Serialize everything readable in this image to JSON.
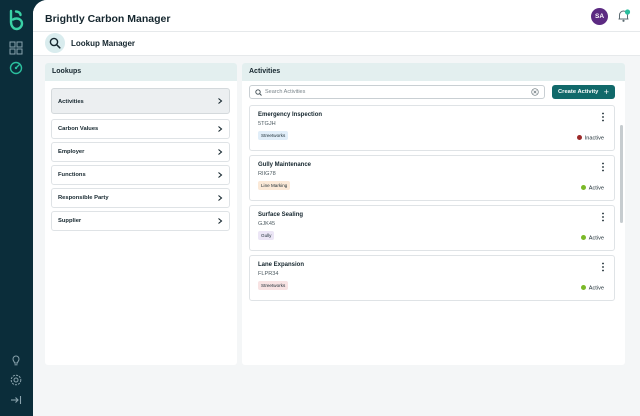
{
  "app": {
    "title": "Brightly Carbon Manager",
    "logo_icon": "brightly-logo-icon"
  },
  "rail": {
    "items": [
      "grid-icon",
      "gauge-icon",
      "lightbulb-icon",
      "settings-icon",
      "logout-icon"
    ]
  },
  "user": {
    "initials": "SA",
    "avatar_color": "#5c2a82"
  },
  "page": {
    "title": "Lookup Manager",
    "icon": "search-icon"
  },
  "lookups": {
    "title": "Lookups",
    "items": [
      {
        "label": "Activities",
        "active": true
      },
      {
        "label": "Carbon Values"
      },
      {
        "label": "Employer"
      },
      {
        "label": "Functions"
      },
      {
        "label": "Responsible Party"
      },
      {
        "label": "Supplier"
      }
    ]
  },
  "activities": {
    "title": "Activities",
    "search_placeholder": "Search Activities",
    "create_label": "Create Activity",
    "create_icon": "+",
    "items": [
      {
        "name": "Emergency Inspection",
        "code": "5TGJH",
        "tag": "Streetworks",
        "tag_color": "#e1eef9",
        "status": "Inactive",
        "status_color": "#9c2a2a"
      },
      {
        "name": "Gully Maintenance",
        "code": "RIIG78",
        "tag": "Line Marking",
        "tag_color": "#fbe9d7",
        "status": "Active",
        "status_color": "#7bb928"
      },
      {
        "name": "Surface Sealing",
        "code": "GJK45",
        "tag": "Gully",
        "tag_color": "#ece6f6",
        "status": "Active",
        "status_color": "#7bb928"
      },
      {
        "name": "Lane Expansion",
        "code": "FLPR34",
        "tag": "Streetworks",
        "tag_color": "#f8e3e3",
        "status": "Active",
        "status_color": "#7bb928"
      }
    ]
  },
  "colors": {
    "primary": "#11696a",
    "sidebar": "#0b2d3a",
    "panel_header": "#e3efef",
    "accent": "#2bbf9e"
  }
}
